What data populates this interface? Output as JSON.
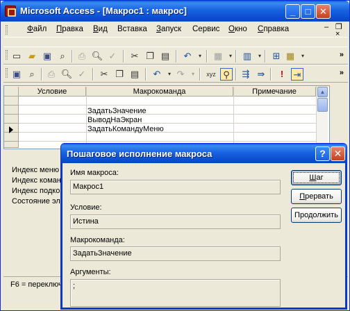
{
  "window": {
    "title": "Microsoft Access - [Макрос1 : макрос]",
    "controls": {
      "minimize": "_",
      "maximize": "□",
      "close": "✕"
    }
  },
  "menu": {
    "items": [
      {
        "hot": "Ф",
        "rest": "айл"
      },
      {
        "hot": "П",
        "rest": "равка"
      },
      {
        "hot": "В",
        "rest": "ид"
      },
      {
        "hot": "",
        "rest": "Вставка"
      },
      {
        "hot": "З",
        "rest": "апуск"
      },
      {
        "hot": "",
        "rest": "Сервис"
      },
      {
        "hot": "О",
        "rest": "кно"
      },
      {
        "hot": "С",
        "rest": "правка"
      }
    ],
    "mdi_controls": {
      "minimize": "–",
      "restore": "❐",
      "close": "×"
    }
  },
  "toolbar1": {
    "icons": [
      "new-icon",
      "open-icon",
      "save-icon",
      "file-search-icon",
      "print-icon",
      "print-preview-icon",
      "spelling-icon",
      "cut-icon",
      "copy-icon",
      "paste-icon",
      "undo-icon",
      "analyze-icon",
      "office-links-icon",
      "relationships-icon",
      "new-object-icon"
    ]
  },
  "toolbar2": {
    "icons": [
      "save-icon",
      "database-window-icon",
      "print-preview-icon",
      "cut-icon",
      "copy-icon",
      "paste-icon",
      "undo-icon",
      "redo-icon",
      "macro-names-icon",
      "conditions-icon",
      "insert-rows-icon",
      "delete-rows-icon",
      "run-icon",
      "single-step-icon"
    ]
  },
  "grid": {
    "headers": [
      "Условие",
      "Макрокоманда",
      "Примечание"
    ],
    "rows": [
      {
        "action": ""
      },
      {
        "action": "ЗадатьЗначение"
      },
      {
        "action": "ВыводНаЭкран"
      },
      {
        "action": "ЗадатьКомандуМеню"
      },
      {
        "action": ""
      }
    ]
  },
  "lower_pane": {
    "lines": [
      "Индекс меню",
      "Индекс коман",
      "Индекс подко",
      "Состояние эле"
    ]
  },
  "statusbar": {
    "text": "F6 = переключ"
  },
  "dialog": {
    "title": "Пошаговое исполнение макроса",
    "help": "?",
    "close": "✕",
    "macro_name_label": "Имя макроса:",
    "macro_name_value": "Макрос1",
    "condition_label": "Условие:",
    "condition_value": "Истина",
    "action_label": "Макрокоманда:",
    "action_value": "ЗадатьЗначение",
    "arguments_label": "Аргументы:",
    "arguments_value": ";",
    "buttons": {
      "step": {
        "hot": "Ш",
        "rest": "аг"
      },
      "halt": {
        "hot": "П",
        "rest": "рервать"
      },
      "continue": {
        "pre": "Про",
        "hot": "д",
        "rest": "олжить"
      }
    }
  }
}
